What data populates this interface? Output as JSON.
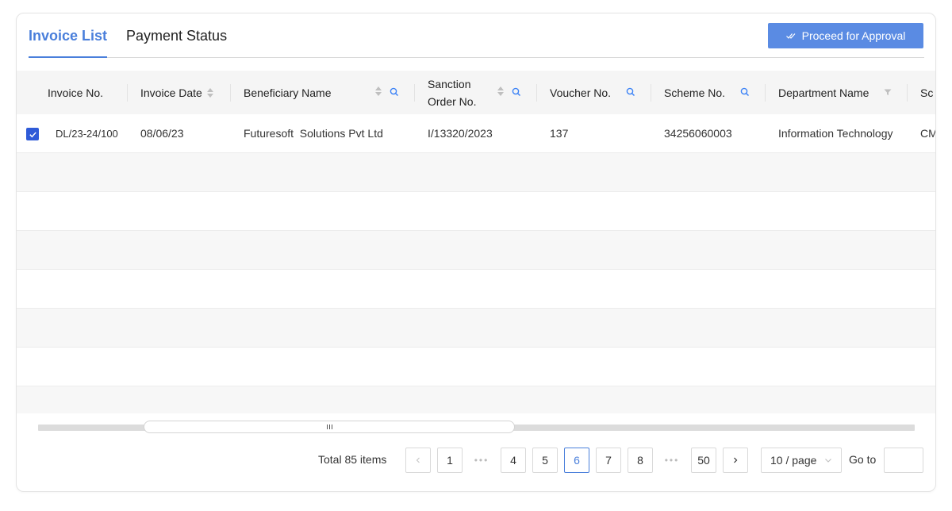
{
  "tabs": [
    {
      "label": "Invoice List",
      "active": true
    },
    {
      "label": "Payment Status",
      "active": false
    }
  ],
  "toolbar": {
    "approve_label": "Proceed for Approval"
  },
  "table": {
    "columns": [
      {
        "label": "Invoice No."
      },
      {
        "label": "Invoice Date",
        "sortable": true
      },
      {
        "label": "Beneficiary Name",
        "sortable": true,
        "searchable": true
      },
      {
        "label": "Sanction",
        "label2": "Order No.",
        "sortable": true,
        "searchable": true
      },
      {
        "label": "Voucher No.",
        "searchable": true
      },
      {
        "label": "Scheme No.",
        "searchable": true
      },
      {
        "label": "Department Name",
        "filterable": true
      },
      {
        "label": "Sc"
      }
    ],
    "rows": [
      {
        "selected": true,
        "invoice_no": "DL/23-24/100",
        "invoice_date": "08/06/23",
        "beneficiary": "Futuresoft  Solutions Pvt Ltd",
        "sanction_order": "I/13320/2023",
        "voucher_no": "137",
        "scheme_no": "34256060003",
        "department": "Information Technology",
        "scheme_partial": "CM"
      }
    ]
  },
  "pagination": {
    "total_text": "Total 85 items",
    "pages": [
      "1",
      "4",
      "5",
      "6",
      "7",
      "8",
      "50"
    ],
    "current": "6",
    "page_size": "10 / page",
    "goto_label": "Go to",
    "goto_value": ""
  },
  "colors": {
    "accent": "#4a7fdb",
    "button": "#5a8be3",
    "checkbox": "#2f5bd8",
    "header_bg": "#f5f5f5"
  },
  "icons": {
    "approve": "double-check-icon",
    "search": "search-icon",
    "filter": "filter-icon",
    "prev": "chevron-left-icon",
    "next": "chevron-right-icon",
    "select": "chevron-down-icon"
  }
}
